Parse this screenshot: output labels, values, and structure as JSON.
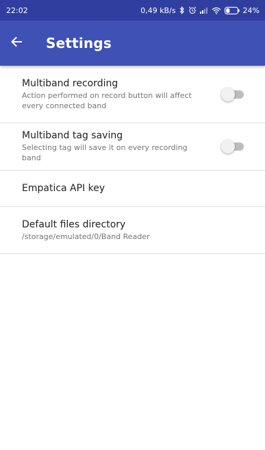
{
  "status_bar": {
    "time": "22:02",
    "network_speed": "0,49 kB/s",
    "battery_percent": "24%",
    "icons": [
      "bluetooth-icon",
      "alarm-icon",
      "signal-icon",
      "wifi-icon",
      "battery-icon"
    ]
  },
  "app_bar": {
    "title": "Settings",
    "back_icon": "arrow-back-icon"
  },
  "settings": [
    {
      "title": "Multiband recording",
      "summary": "Action performed on record button will affect every connected band",
      "toggle_on": false
    },
    {
      "title": "Multiband tag saving",
      "summary": "Selecting tag will save it on every recording band",
      "toggle_on": false
    },
    {
      "title": "Empatica API key"
    },
    {
      "title": "Default files directory",
      "summary": "/storage/emulated/0/Band Reader"
    }
  ],
  "colors": {
    "primary": "#3f51b5",
    "primary_dark": "#303f9f",
    "divider": "#e0e0e0",
    "toggle_track_off": "#bdbdbd",
    "toggle_thumb_off": "#f1f1f1"
  }
}
